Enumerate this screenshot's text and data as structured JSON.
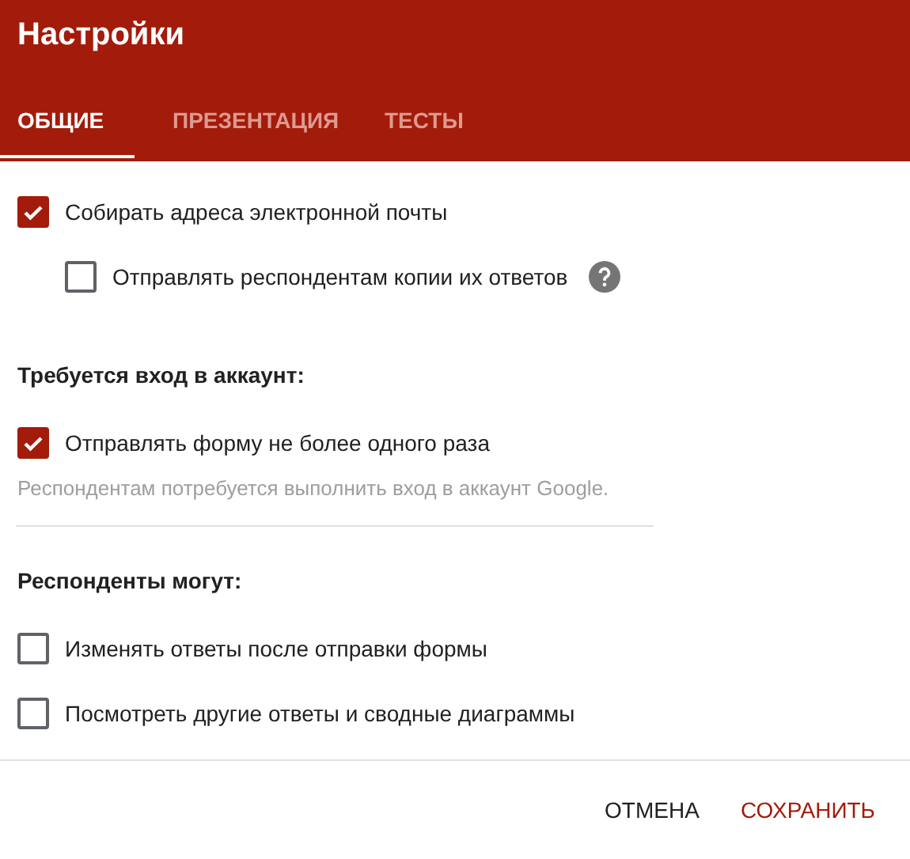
{
  "header": {
    "title": "Настройки"
  },
  "tabs": [
    {
      "label": "ОБЩИЕ",
      "selected": true
    },
    {
      "label": "ПРЕЗЕНТАЦИЯ",
      "selected": false
    },
    {
      "label": "ТЕСТЫ",
      "selected": false
    }
  ],
  "sections": [
    {
      "options": [
        {
          "label": "Собирать адреса электронной почты",
          "checked": true,
          "help": false,
          "children": [
            {
              "label": "Отправлять респондентам копии их ответов",
              "checked": false,
              "help": true
            }
          ]
        }
      ],
      "divider": false
    },
    {
      "heading": "Требуется вход в аккаунт:",
      "options": [
        {
          "label": "Отправлять форму не более одного раза",
          "checked": true,
          "help": false
        }
      ],
      "note": "Респондентам потребуется выполнить вход в аккаунт Google.",
      "divider": true
    },
    {
      "heading": "Респонденты могут:",
      "options": [
        {
          "label": "Изменять ответы после отправки формы",
          "checked": false,
          "help": false
        },
        {
          "label": "Посмотреть другие ответы и сводные диаграммы",
          "checked": false,
          "help": false
        }
      ],
      "divider": false
    }
  ],
  "buttons": [
    {
      "label": "ОТМЕНА",
      "kind": "cancel"
    },
    {
      "label": "СОХРАНИТЬ",
      "kind": "primary"
    }
  ]
}
